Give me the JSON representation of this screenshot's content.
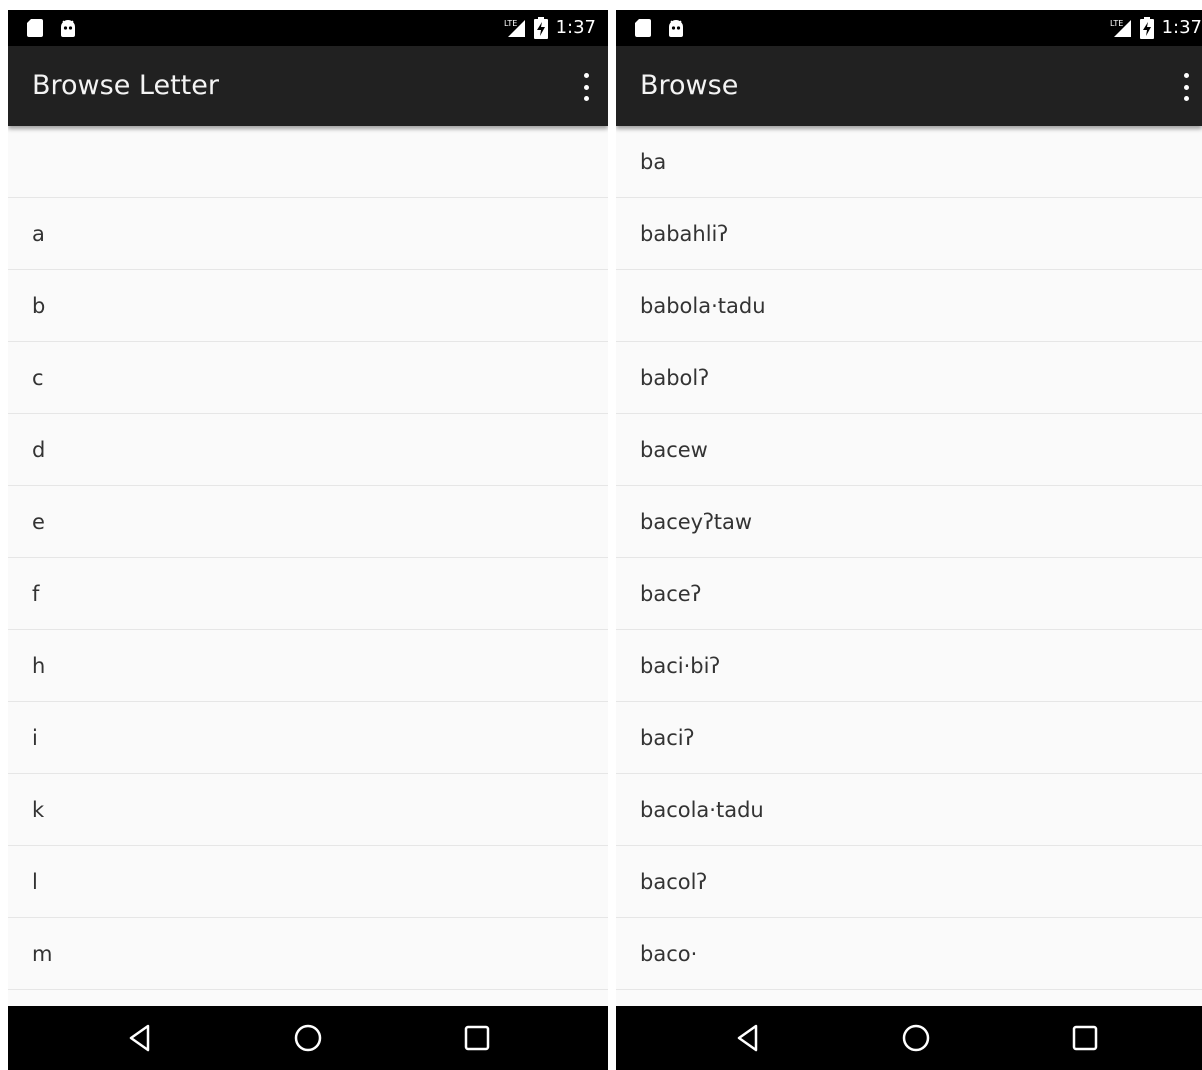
{
  "left_screen": {
    "status": {
      "time": "1:37",
      "icons": [
        "sd-card-icon",
        "android-debug-icon",
        "lte-signal-icon",
        "battery-charging-icon"
      ]
    },
    "app_bar": {
      "title": "Browse Letter",
      "menu_icon": "more-vert-icon"
    },
    "items": [
      "",
      "a",
      "b",
      "c",
      "d",
      "e",
      "f",
      "h",
      "i",
      "k",
      "l",
      "m"
    ],
    "nav": {
      "icons": [
        "back-icon",
        "home-icon",
        "recents-icon"
      ]
    }
  },
  "right_screen": {
    "status": {
      "time": "1:37",
      "icons": [
        "sd-card-icon",
        "android-debug-icon",
        "lte-signal-icon",
        "battery-charging-icon"
      ]
    },
    "app_bar": {
      "title": "Browse",
      "menu_icon": "more-vert-icon"
    },
    "items": [
      "ba",
      "babahliʔ",
      "babola·tadu",
      "babolʔ",
      "bacew",
      "baceyʔtaw",
      "baceʔ",
      "baci·biʔ",
      "baciʔ",
      "bacola·tadu",
      "bacolʔ",
      "baco·"
    ],
    "nav": {
      "icons": [
        "back-icon",
        "home-icon",
        "recents-icon"
      ]
    }
  },
  "colors": {
    "status_bar": "#000000",
    "app_bar": "#212121",
    "list_background": "#fafafa",
    "divider": "#e6e6e6",
    "text": "#333333"
  }
}
